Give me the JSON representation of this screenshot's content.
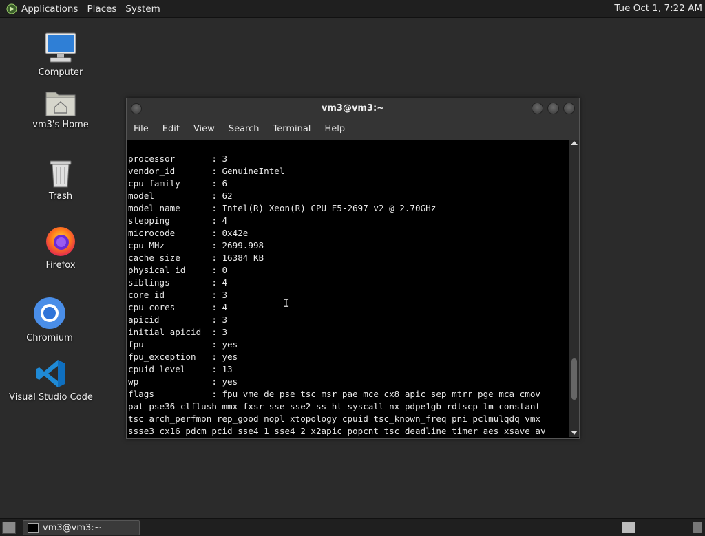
{
  "top_panel": {
    "menus": [
      "Applications",
      "Places",
      "System"
    ],
    "clock": "Tue Oct  1, 7:22 AM"
  },
  "desktop": {
    "icons": [
      {
        "label": "Computer",
        "icon": "computer-icon"
      },
      {
        "label": "vm3's Home",
        "icon": "home-folder-icon"
      },
      {
        "label": "Trash",
        "icon": "trash-icon"
      },
      {
        "label": "Firefox",
        "icon": "firefox-icon"
      },
      {
        "label": "Chromium",
        "icon": "chromium-icon"
      },
      {
        "label": "Visual Studio Code",
        "icon": "vscode-icon"
      }
    ]
  },
  "terminal": {
    "title": "vm3@vm3:~",
    "menu": [
      "File",
      "Edit",
      "View",
      "Search",
      "Terminal",
      "Help"
    ],
    "lines": [
      "processor       : 3",
      "vendor_id       : GenuineIntel",
      "cpu family      : 6",
      "model           : 62",
      "model name      : Intel(R) Xeon(R) CPU E5-2697 v2 @ 2.70GHz",
      "stepping        : 4",
      "microcode       : 0x42e",
      "cpu MHz         : 2699.998",
      "cache size      : 16384 KB",
      "physical id     : 0",
      "siblings        : 4",
      "core id         : 3",
      "cpu cores       : 4",
      "apicid          : 3",
      "initial apicid  : 3",
      "fpu             : yes",
      "fpu_exception   : yes",
      "cpuid level     : 13",
      "wp              : yes",
      "flags           : fpu vme de pse tsc msr pae mce cx8 apic sep mtrr pge mca cmov",
      "pat pse36 clflush mmx fxsr sse sse2 ss ht syscall nx pdpe1gb rdtscp lm constant_",
      "tsc arch_perfmon rep_good nopl xtopology cpuid tsc_known_freq pni pclmulqdq vmx",
      "ssse3 cx16 pdcm pcid sse4_1 sse4_2 x2apic popcnt tsc_deadline_timer aes xsave av"
    ]
  },
  "taskbar": {
    "task_label": "vm3@vm3:~"
  }
}
